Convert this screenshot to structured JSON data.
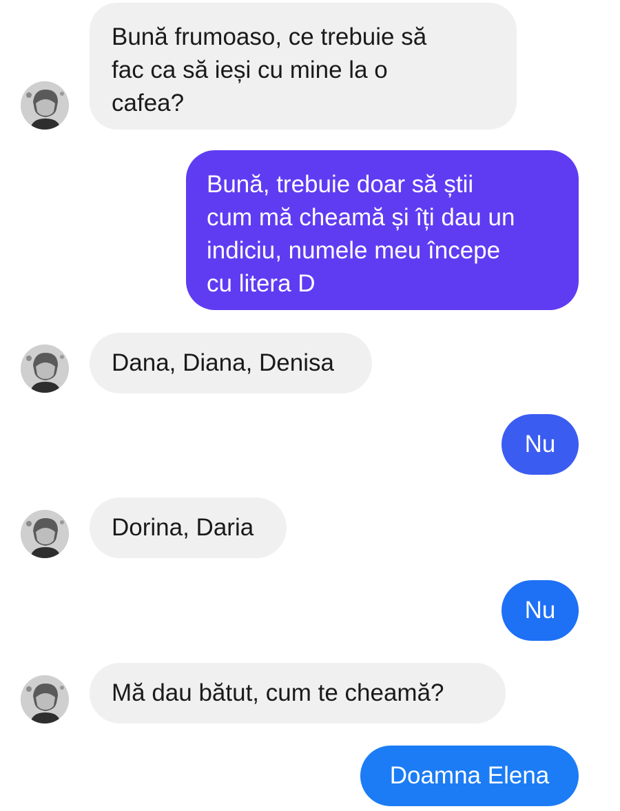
{
  "conversation": {
    "messages": [
      {
        "sender": "contact",
        "text": "Bună frumoaso, ce trebuie să\nfac ca să ieși cu mine la o\ncafea?"
      },
      {
        "sender": "me",
        "text": "Bună, trebuie doar să știi\ncum mă cheamă și îți dau un\nindiciu, numele meu începe\ncu litera D"
      },
      {
        "sender": "contact",
        "text": "Dana, Diana, Denisa"
      },
      {
        "sender": "me",
        "text": "Nu"
      },
      {
        "sender": "contact",
        "text": "Dorina, Daria"
      },
      {
        "sender": "me",
        "text": "Nu"
      },
      {
        "sender": "contact",
        "text": "Mă dau bătut, cum te cheamă?"
      },
      {
        "sender": "me",
        "text": "Doamna Elena"
      }
    ]
  },
  "colors": {
    "incoming_bubble": "#f0f0f1",
    "outgoing_gradient": [
      "#5f3cf2",
      "#3b5cf1",
      "#1e70f5",
      "#1b7cf5"
    ],
    "incoming_text": "#1a1a1a",
    "outgoing_text": "#ffffff"
  },
  "icons": {
    "contact_avatar": "avatar"
  }
}
